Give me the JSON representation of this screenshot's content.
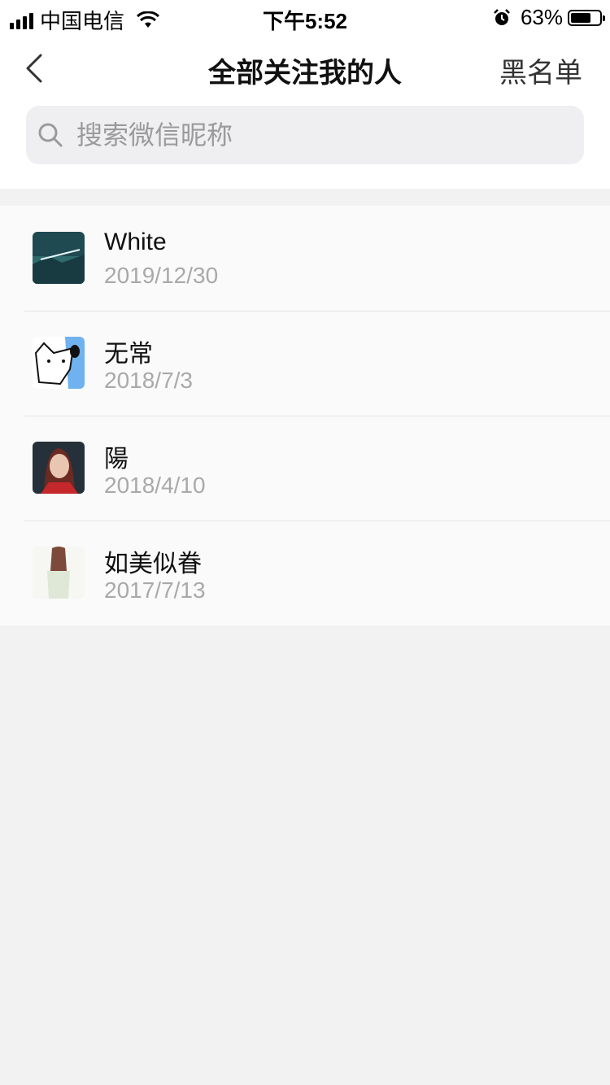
{
  "status_bar": {
    "carrier": "中国电信",
    "time": "下午5:52",
    "battery_text": "63%",
    "battery_level": 0.63
  },
  "nav": {
    "title": "全部关注我的人",
    "right_label": "黑名单",
    "back_icon": "chevron-left-icon"
  },
  "search": {
    "placeholder": "搜索微信昵称",
    "value": ""
  },
  "followers": [
    {
      "name": "White",
      "date": "2019/12/30"
    },
    {
      "name": "无常",
      "date": "2018/7/3"
    },
    {
      "name": "陽",
      "date": "2018/4/10"
    },
    {
      "name": "如美似眷",
      "date": "2017/7/13"
    }
  ]
}
